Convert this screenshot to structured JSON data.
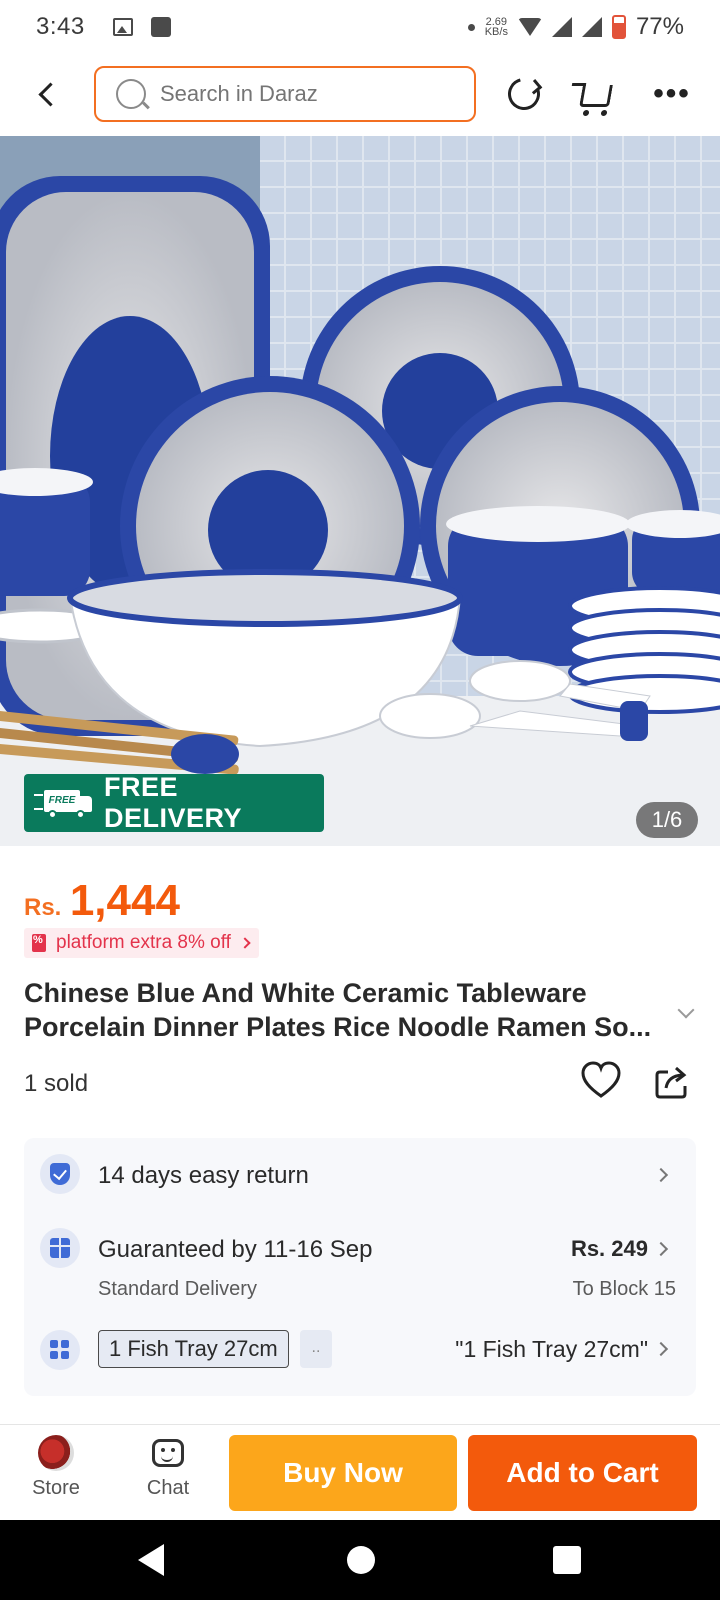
{
  "status_bar": {
    "time": "3:43",
    "net_speed_value": "2.69",
    "net_speed_unit": "KB/s",
    "battery": "77%"
  },
  "header": {
    "search_placeholder": "Search in Daraz"
  },
  "gallery": {
    "badge_text": "FREE DELIVERY",
    "badge_truck_label": "FREE",
    "counter": "1/6"
  },
  "price": {
    "currency": "Rs.",
    "value": "1,444"
  },
  "promo": {
    "label": "platform extra 8% off"
  },
  "product": {
    "title": "Chinese Blue And White Ceramic Tableware Porcelain Dinner Plates Rice Noodle Ramen So...",
    "sold": "1 sold"
  },
  "info": {
    "return_text": "14 days easy return",
    "delivery_main": "Guaranteed by 11-16 Sep",
    "delivery_sub": "Standard Delivery",
    "delivery_price": "Rs. 249",
    "delivery_location": "To Block 15",
    "variant_chip": "1 Fish Tray 27cm",
    "variant_more": "..",
    "variant_selected": "\"1 Fish Tray 27cm\""
  },
  "bottom_bar": {
    "store_label": "Store",
    "chat_label": "Chat",
    "buy_now": "Buy Now",
    "add_to_cart": "Add to Cart"
  },
  "colors": {
    "brand_orange": "#f35a0c",
    "buy_now_yellow": "#fca61b",
    "delivery_green": "#0a7a5c",
    "promo_red": "#e3334b"
  }
}
